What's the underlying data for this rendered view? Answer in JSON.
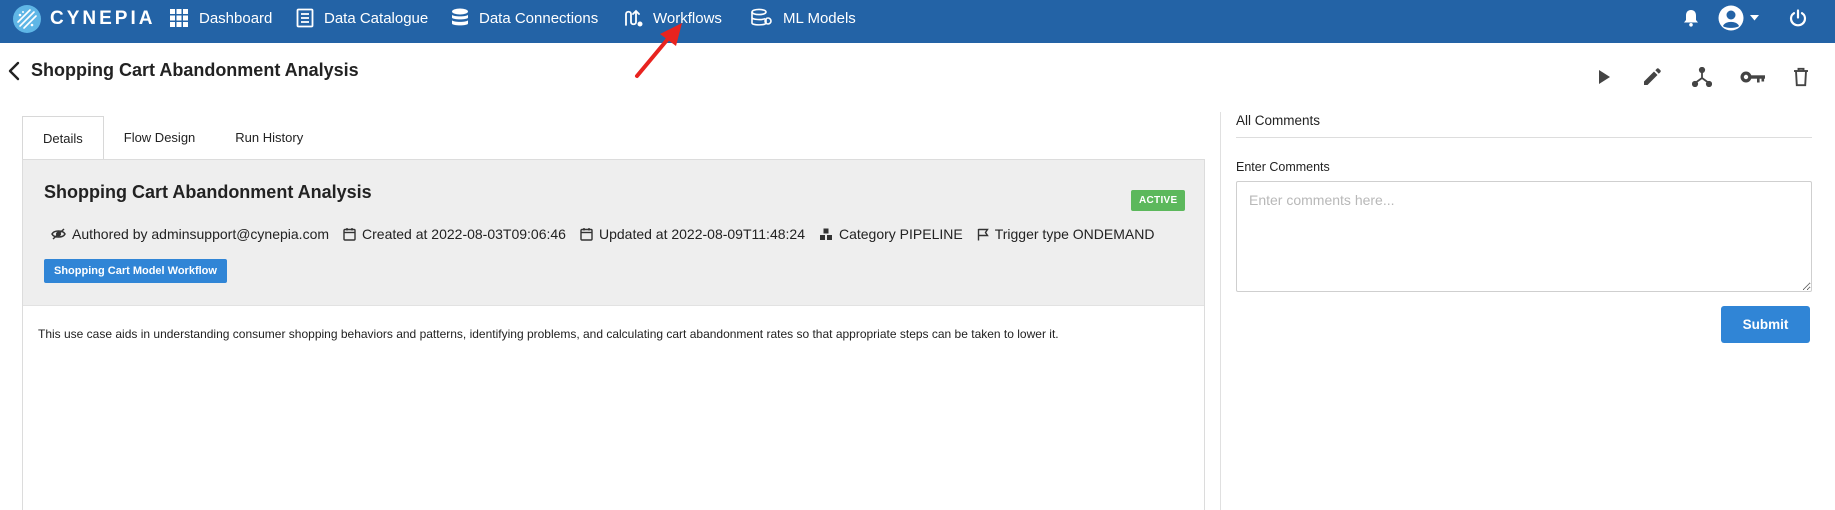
{
  "brand": {
    "name": "CYNEPIA"
  },
  "nav": {
    "items": [
      {
        "label": "Dashboard",
        "icon": "dashboard-grid-icon"
      },
      {
        "label": "Data Catalogue",
        "icon": "catalogue-icon"
      },
      {
        "label": "Data Connections",
        "icon": "database-icon"
      },
      {
        "label": "Workflows",
        "icon": "workflow-icon"
      },
      {
        "label": "ML Models",
        "icon": "ml-model-icon"
      }
    ],
    "right_icons": [
      "bell-icon",
      "user-avatar-icon",
      "caret-down-icon",
      "power-icon"
    ]
  },
  "page": {
    "title": "Shopping Cart Abandonment Analysis",
    "toolbar_icons": [
      "play-icon",
      "edit-pencil-icon",
      "fork-icon",
      "key-icon",
      "trash-icon"
    ]
  },
  "tabs": [
    {
      "label": "Details",
      "active": true
    },
    {
      "label": "Flow Design",
      "active": false
    },
    {
      "label": "Run History",
      "active": false
    }
  ],
  "details": {
    "title": "Shopping Cart Abandonment Analysis",
    "status": "ACTIVE",
    "meta": {
      "authored": "Authored by adminsupport@cynepia.com",
      "created": "Created at 2022-08-03T09:06:46",
      "updated": "Updated at 2022-08-09T11:48:24",
      "category": "Category PIPELINE",
      "trigger": "Trigger type ONDEMAND"
    },
    "tag": "Shopping Cart Model Workflow",
    "description": "This use case aids in understanding consumer shopping behaviors and patterns, identifying problems, and calculating cart abandonment rates so that appropriate steps can be taken to lower it."
  },
  "comments": {
    "header": "All Comments",
    "label": "Enter Comments",
    "placeholder": "Enter comments here...",
    "submit": "Submit"
  },
  "colors": {
    "topbar": "#2363a6",
    "active_badge": "#5cb85c",
    "primary_button": "#3085d6",
    "annotation_arrow": "#e8231f"
  }
}
